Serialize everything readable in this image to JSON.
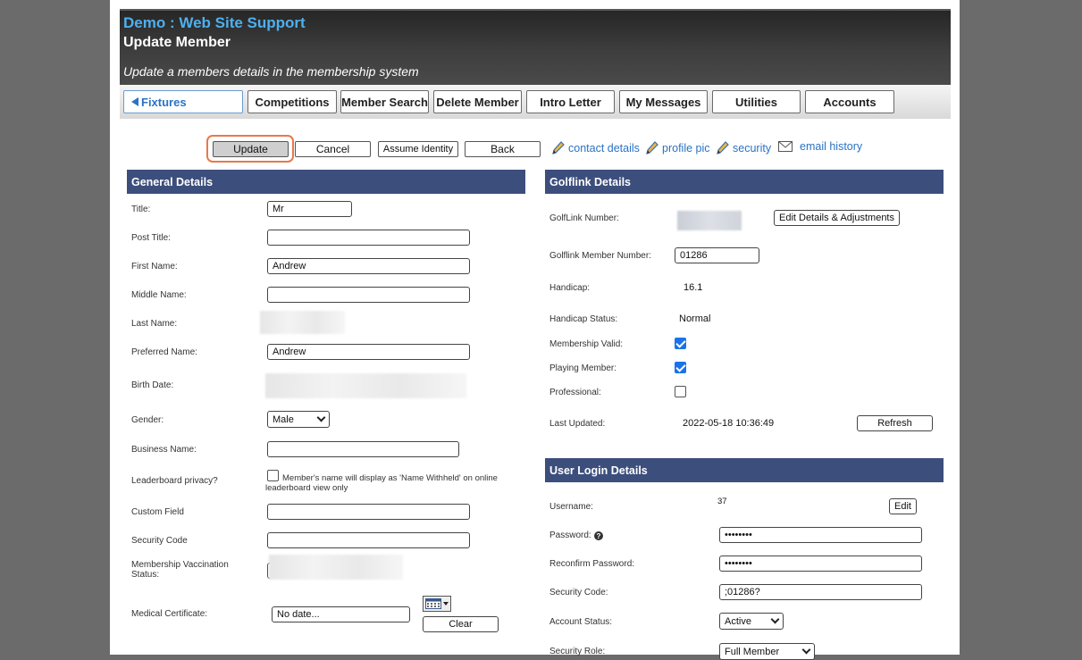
{
  "header": {
    "site_name": "Demo : Web Site Support",
    "page_title": "Update Member",
    "subtitle": "Update a members details in the membership system"
  },
  "nav": {
    "tabs": [
      "Fixtures",
      "Competitions",
      "Member Search",
      "Delete Member",
      "Intro Letter",
      "My Messages",
      "Utilities",
      "Accounts"
    ],
    "active_tab": "Fixtures"
  },
  "toolbar": {
    "update_label": "Update",
    "cancel_label": "Cancel",
    "assume_identity_label": "Assume Identity",
    "back_label": "Back",
    "contact_details_link": "contact details",
    "profile_pic_link": "profile pic",
    "security_link": "security",
    "email_history_link": "email history"
  },
  "general": {
    "heading": "General Details",
    "title_label": "Title:",
    "title_value": "Mr",
    "post_title_label": "Post Title:",
    "post_title_value": "",
    "first_name_label": "First Name:",
    "first_name_value": "Andrew",
    "middle_name_label": "Middle Name:",
    "middle_name_value": "",
    "last_name_label": "Last Name:",
    "preferred_name_label": "Preferred Name:",
    "preferred_name_value": "Andrew",
    "birth_date_label": "Birth Date:",
    "gender_label": "Gender:",
    "gender_value": "Male",
    "business_name_label": "Business Name:",
    "leaderboard_label": "Leaderboard privacy?",
    "leaderboard_text": "Member's name will display as 'Name Withheld' on online leaderboard view only",
    "leaderboard_checked": false,
    "custom_field_label": "Custom Field",
    "security_code_label": "Security Code",
    "vaccination_label_1": "Membership Vaccination",
    "vaccination_label_2": "Status:",
    "medical_cert_label": "Medical Certificate:",
    "medical_cert_value": "No date...",
    "clear_label": "Clear"
  },
  "golflink": {
    "heading": "Golflink Details",
    "number_label": "GolfLink Number:",
    "edit_adjust_label": "Edit Details & Adjustments",
    "member_number_label": "Golflink Member Number:",
    "member_number_value": "01286",
    "handicap_label": "Handicap:",
    "handicap_value": "16.1",
    "handicap_status_label": "Handicap Status:",
    "handicap_status_value": "Normal",
    "membership_valid_label": "Membership Valid:",
    "membership_valid": true,
    "playing_member_label": "Playing Member:",
    "playing_member": true,
    "professional_label": "Professional:",
    "professional": false,
    "last_updated_label": "Last Updated:",
    "last_updated_value": "2022-05-18 10:36:49",
    "refresh_label": "Refresh"
  },
  "login": {
    "heading": "User Login Details",
    "username_label": "Username:",
    "username_value": "37",
    "edit_label": "Edit",
    "password_label": "Password:",
    "password_value": "••••••••",
    "reconfirm_label": "Reconfirm Password:",
    "reconfirm_value": "••••••••",
    "security_code_label": "Security Code:",
    "security_code_value": ";01286?",
    "account_status_label": "Account Status:",
    "account_status_value": "Active",
    "security_role_label": "Security Role:",
    "security_role_value": "Full Member"
  },
  "colors": {
    "section_header": "#3c4e7c",
    "link": "#2a73c4",
    "site_name": "#4fb0ee",
    "focus_ring": "#e8784a",
    "checkbox_on": "#1a73e8"
  }
}
